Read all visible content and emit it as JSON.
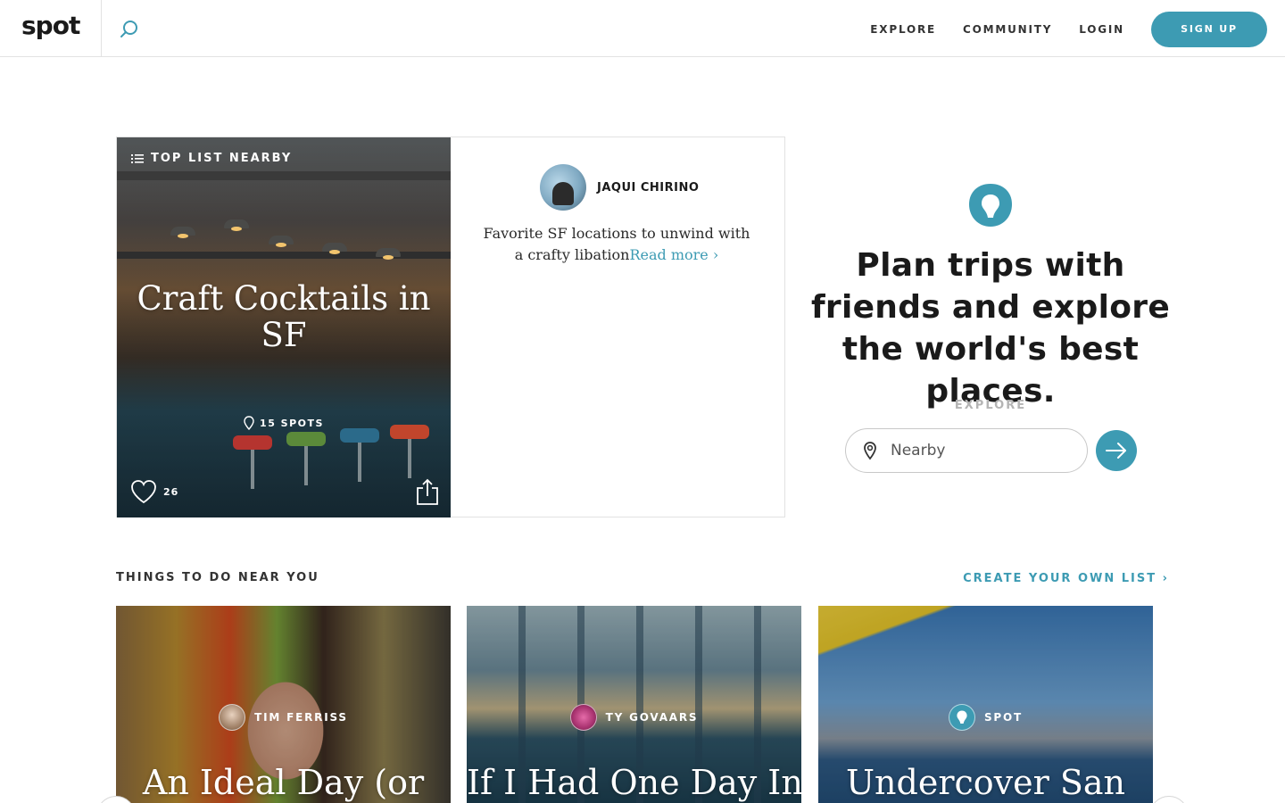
{
  "header": {
    "logo": "spot",
    "nav": [
      {
        "label": "EXPLORE"
      },
      {
        "label": "COMMUNITY"
      },
      {
        "label": "LOGIN"
      }
    ],
    "signup_label": "SIGN UP"
  },
  "featured": {
    "tag": "TOP LIST NEARBY",
    "title": "Craft Cocktails in SF",
    "spots": "15 SPOTS",
    "likes": "26",
    "author": "JAQUI CHIRINO",
    "description": "Favorite SF locations to unwind with a crafty libation",
    "read_more": "Read more ›"
  },
  "hero": {
    "title": "Plan trips with friends and explore the world's best places.",
    "explore_label": "EXPLORE",
    "search_placeholder": "Nearby"
  },
  "section": {
    "title": "THINGS TO DO NEAR YOU",
    "create_link": "CREATE YOUR OWN LIST ›",
    "cards": [
      {
        "author": "TIM FERRISS",
        "title": "An Ideal Day (or"
      },
      {
        "author": "TY GOVAARS",
        "title": "If I Had One Day In"
      },
      {
        "author": "SPOT",
        "title": "Undercover San"
      }
    ]
  },
  "colors": {
    "accent": "#3d9bb3",
    "text": "#1a1a1a",
    "muted": "#b4b4b4",
    "border": "#e2e2e2"
  },
  "icons": {
    "search": "search-icon",
    "list": "list-icon",
    "pin": "map-pin-icon",
    "heart": "heart-icon",
    "share": "share-icon",
    "arrow": "arrow-right-icon",
    "spot_logo": "spot-pin-logo-icon"
  }
}
